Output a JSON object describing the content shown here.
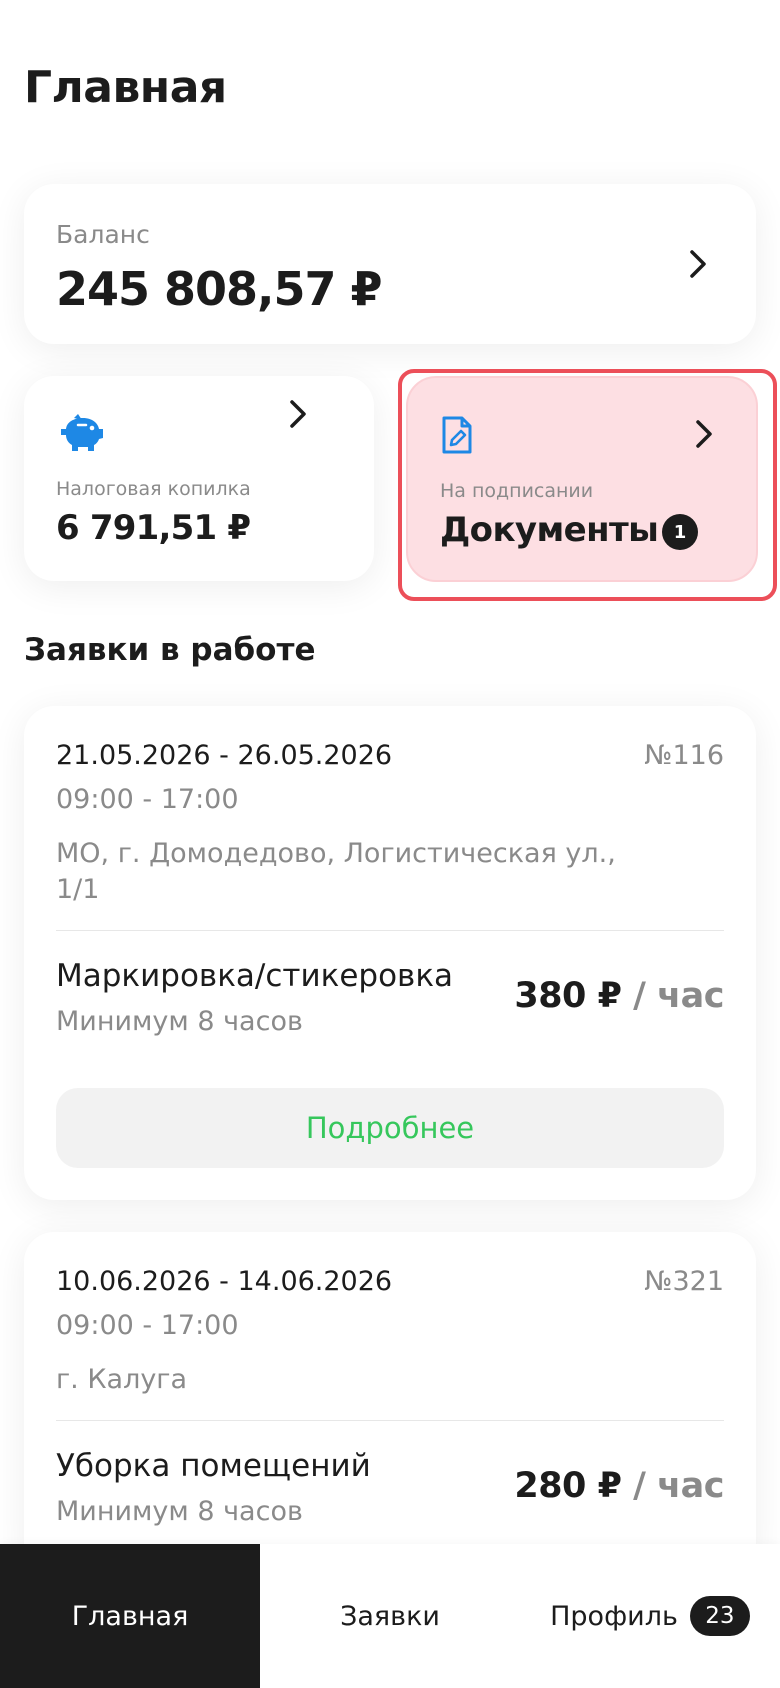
{
  "header": {
    "title": "Главная"
  },
  "balance": {
    "label": "Баланс",
    "amount": "245 808,57 ₽"
  },
  "tax_piggy": {
    "label": "Налоговая копилка",
    "amount": "6 791,51 ₽",
    "icon": "piggy-bank-icon"
  },
  "documents": {
    "label": "На подписании",
    "title": "Документы",
    "count": "1",
    "icon": "file-sign-icon"
  },
  "section": {
    "title": "Заявки в работе"
  },
  "orders": [
    {
      "dates": "21.05.2026 - 26.05.2026",
      "number": "№116",
      "time": "09:00 - 17:00",
      "address": "МО, г. Домодедово, Логистическая ул., 1/1",
      "job": "Маркировка/стикеровка",
      "minimum": "Минимум 8 часов",
      "price": "380 ₽",
      "unit": " / час",
      "more_label": "Подробнее"
    },
    {
      "dates": "10.06.2026 - 14.06.2026",
      "number": "№321",
      "time": "09:00 - 17:00",
      "address": "г. Калуга",
      "job": "Уборка помещений",
      "minimum": "Минимум 8 часов",
      "price": "280 ₽",
      "unit": " / час"
    }
  ],
  "nav": {
    "home": "Главная",
    "orders": "Заявки",
    "profile": "Профиль",
    "profile_badge": "23"
  },
  "colors": {
    "accent_green": "#36c75c",
    "icon_blue": "#1e88e5",
    "highlight_red": "#ec4f59",
    "docs_bg": "#fddfe3"
  }
}
